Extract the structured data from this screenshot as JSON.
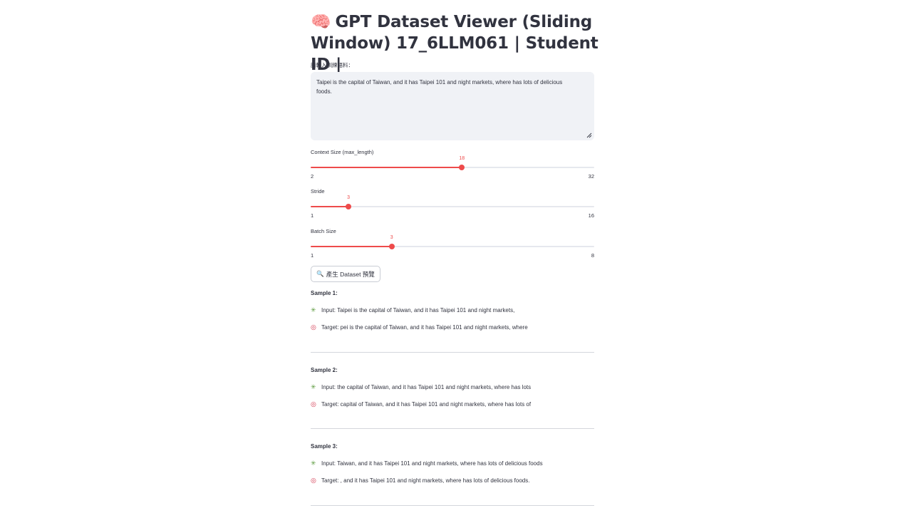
{
  "title": "GPT Dataset Viewer (Sliding Window) 17_6LLM061 | Student ID |",
  "title_icon": "brain-icon",
  "input": {
    "label": "請輸入訓練語料：",
    "value": "Taipei is the capital of Taiwan, and it has Taipei 101 and night markets, where has lots of delicious foods."
  },
  "sliders": {
    "context": {
      "label": "Context Size (max_length)",
      "value": "18",
      "min": "2",
      "max": "32",
      "fraction": 0.5333
    },
    "stride": {
      "label": "Stride",
      "value": "3",
      "min": "1",
      "max": "16",
      "fraction": 0.1333
    },
    "batch": {
      "label": "Batch Size",
      "value": "3",
      "min": "1",
      "max": "8",
      "fraction": 0.2857
    }
  },
  "button": {
    "icon": "magnifier-icon",
    "label": "產生 Dataset 預覽"
  },
  "samples": [
    {
      "title": "Sample 1:",
      "input": "Input: Taipei is the capital of Taiwan, and it has Taipei 101 and night markets,",
      "target": "Target: pei is the capital of Taiwan, and it has Taipei 101 and night markets, where"
    },
    {
      "title": "Sample 2:",
      "input": "Input: the capital of Taiwan, and it has Taipei 101 and night markets, where has lots",
      "target": "Target: capital of Taiwan, and it has Taipei 101 and night markets, where has lots of"
    },
    {
      "title": "Sample 3:",
      "input": "Input: Taiwan, and it has Taipei 101 and night markets, where has lots of delicious foods",
      "target": "Target: , and it has Taipei 101 and night markets, where has lots of delicious foods."
    }
  ],
  "icons": {
    "input_line": "puzzle-icon",
    "target_line": "target-icon"
  },
  "colors": {
    "accent": "#ee4b4b",
    "text": "#31333f",
    "input_bg": "#f0f2f6"
  }
}
